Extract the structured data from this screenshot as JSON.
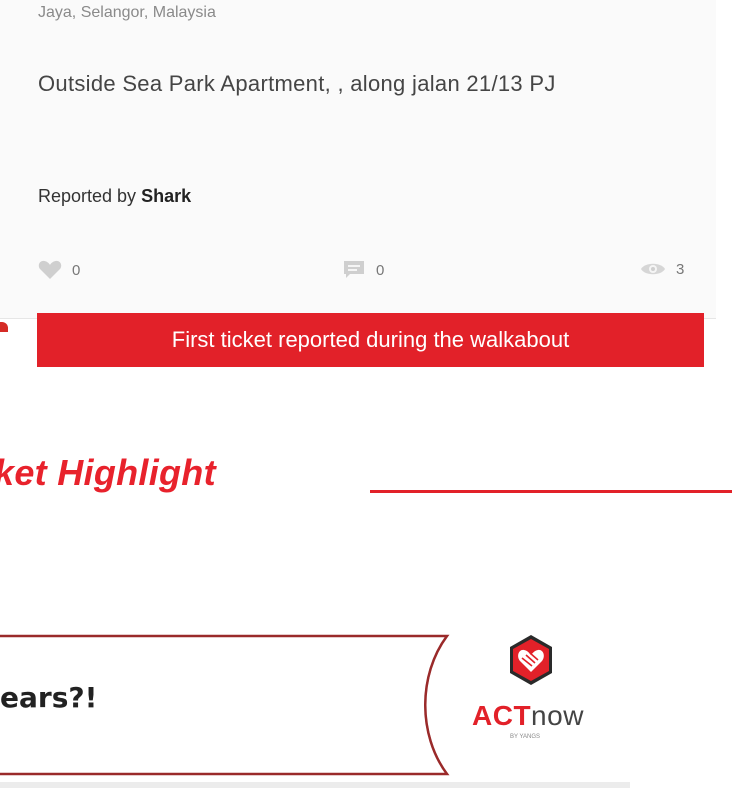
{
  "ticket": {
    "location": "Jaya, Selangor, Malaysia",
    "description": "Outside Sea Park Apartment, , along jalan 21/13 PJ",
    "reported_prefix": "Reported by",
    "reporter": "Shark",
    "likes": "0",
    "comments": "0",
    "views": "3",
    "icons": [
      "heart-icon",
      "comment-icon",
      "eye-icon"
    ]
  },
  "caption": "First ticket reported during the walkabout",
  "section": {
    "title": "ket Highlight"
  },
  "banner": {
    "headline": "ears?!",
    "logo": {
      "brand_act": "ACT",
      "brand_now": "now",
      "tagline": "BY YANGS"
    }
  },
  "colors": {
    "accent": "#e22129",
    "text": "#454545",
    "muted": "#8a8a8a"
  }
}
